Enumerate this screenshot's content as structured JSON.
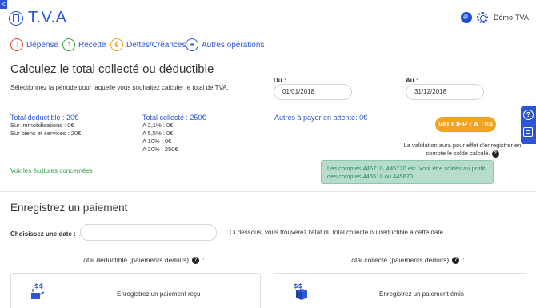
{
  "header": {
    "back_glyph": "<",
    "title": "T.V.A",
    "user": "Démo-TVA",
    "icons": [
      "back-arrow-icon",
      "tva-logo-icon",
      "globe-icon",
      "gear-icon"
    ]
  },
  "nav": [
    {
      "label": "Dépense",
      "icon": "arrow-down-icon",
      "glyph": "↓",
      "color": "#e2452c"
    },
    {
      "label": "Recette",
      "icon": "arrow-up-icon",
      "glyph": "↑",
      "color": "#2e9a4a"
    },
    {
      "label": "Dettes/Créances",
      "icon": "euro-icon",
      "glyph": "€",
      "color": "#f2a21c"
    },
    {
      "label": "Autres opérations",
      "icon": "more-icon",
      "glyph": "•••",
      "color": "#2b55d6"
    }
  ],
  "calc": {
    "title": "Calculez le total collecté ou déductible",
    "description": "Sélectionnez la période pour laquelle vous souhaitez calculer le total de TVA.",
    "du_label": "Du :",
    "du_value": "01/01/2018",
    "au_label": "Au :",
    "au_value": "31/12/2018",
    "deductible": {
      "title": "Total déductible : 20€",
      "lines": [
        "Sur immobilisations : 0€",
        "Sur biens et services : 20€"
      ]
    },
    "collecte": {
      "title": "Total collecté : 250€",
      "lines": [
        "A 2,1% : 0€",
        "A 5,5% : 0€",
        "A 10% : 0€",
        "A 20% : 250€"
      ]
    },
    "attente": "Autres à payer en attente: 0€",
    "valider_label": "VALIDER LA TVA",
    "valider_note": "La validation aura pour effet d'enregistrer en compte le solde calculé.",
    "voir_link": "Voir les écritures concernées",
    "alert": "Les comptes 445710, 445720 etc. vont être soldés au profit des comptes 445510 ou 445670."
  },
  "payment": {
    "title": "Enregistrez un paiement",
    "choose_label": "Choisissez une date :",
    "date_value": "",
    "info": "Ci dessous, vous trouverez l'état du total collecté ou déductible à cette date.",
    "col_deductible": "Total déductible (paiements déduits)",
    "col_collecte": "Total collecté (paiements déduits)",
    "colon": ":",
    "card_recu": "Enregistrez un paiement reçu",
    "card_emis": "Enregistrez un paiement émis"
  },
  "help": {
    "glyph": "?"
  },
  "colors": {
    "accent": "#2b55d6",
    "valider": "#f2a21c",
    "alert_bg": "#b6dccc",
    "link_green": "#2e9a4a"
  }
}
